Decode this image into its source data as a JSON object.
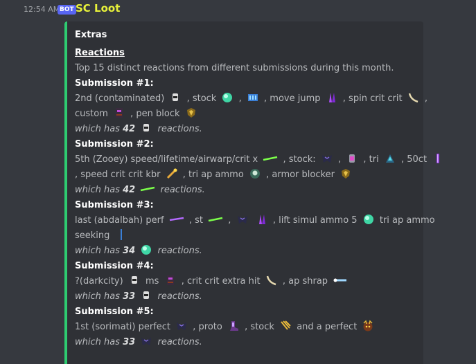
{
  "timestamp": "12:54 AM",
  "bot_tag": "BOT",
  "author": "SC Loot",
  "embed": {
    "title": "Extras",
    "field_name": "Reactions",
    "description": "Top 15 distinct reactions from different submissions during this month.",
    "submissions": [
      {
        "title": "Submission #1:",
        "line1_parts": [
          "2nd (contaminated)",
          ", stock",
          ",",
          ", move jump",
          ", spin crit crit",
          ","
        ],
        "line2_parts": [
          "custom",
          ", pen block"
        ],
        "summary_pre": "which has",
        "count": "42",
        "summary_post": "reactions."
      },
      {
        "title": "Submission #2:",
        "line1_parts": [
          "5th (Zooey) speed/lifetime/airwarp/crit x",
          ", stock:",
          ",",
          ", tri",
          ", 50ct"
        ],
        "line2_parts": [
          ", speed crit crit kbr",
          ", tri ap ammo",
          ", armor blocker"
        ],
        "summary_pre": "which has",
        "count": "42",
        "summary_post": "reactions."
      },
      {
        "title": "Submission #3:",
        "line1_parts": [
          "last (abdalbah) perf",
          ", st",
          ",",
          ", lift simul ammo 5",
          "tri ap ammo"
        ],
        "line2_parts": [
          "seeking"
        ],
        "summary_pre": "which has",
        "count": "34",
        "summary_post": "reactions."
      },
      {
        "title": "Submission #4:",
        "line1_parts": [
          "?(darkcity)",
          "ms",
          ", crit crit extra hit",
          ", ap shrap"
        ],
        "summary_pre": "which has",
        "count": "33",
        "summary_post": "reactions."
      },
      {
        "title": "Submission #5:",
        "line1_parts": [
          "1st (sorimati) perfect",
          ", proto",
          ", stock",
          "and a perfect"
        ],
        "summary_pre": "which has",
        "count": "33",
        "summary_post": "reactions."
      }
    ]
  },
  "colors": {
    "background": "#36393f",
    "embed_bg": "#2f3136",
    "embed_accent": "#2ecc71",
    "author": "#e8f23a",
    "bot_tag": "#5865f2"
  }
}
